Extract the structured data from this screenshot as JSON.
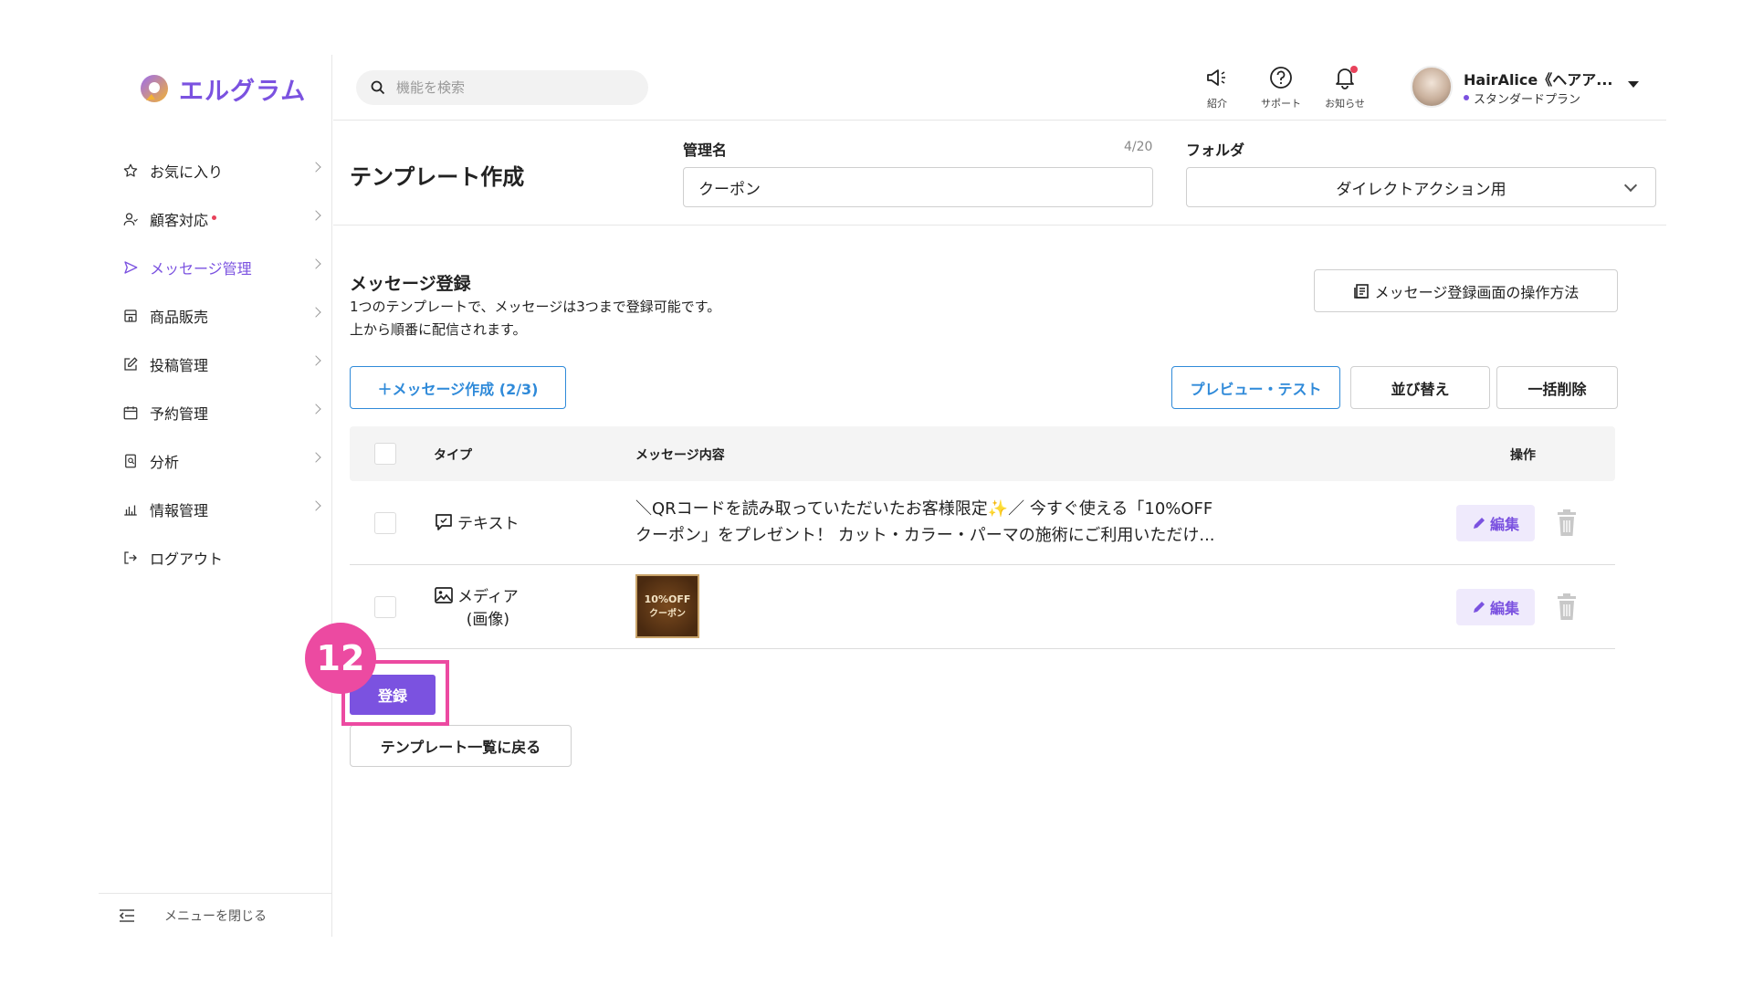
{
  "app": {
    "name": "エルグラム",
    "brand_color": "#7b52e0",
    "accent_pink": "#ec4aa1"
  },
  "sidebar": {
    "items": [
      {
        "label": "お気に入り",
        "icon": "star-icon"
      },
      {
        "label": "顧客対応",
        "icon": "user-icon",
        "has_dot": true
      },
      {
        "label": "メッセージ管理",
        "icon": "send-icon",
        "active": true
      },
      {
        "label": "商品販売",
        "icon": "shop-icon"
      },
      {
        "label": "投稿管理",
        "icon": "edit-icon"
      },
      {
        "label": "予約管理",
        "icon": "calendar-icon"
      },
      {
        "label": "分析",
        "icon": "report-icon"
      },
      {
        "label": "情報管理",
        "icon": "bar-chart-icon"
      },
      {
        "label": "ログアウト",
        "icon": "logout-icon"
      }
    ],
    "footer_label": "メニューを閉じる"
  },
  "header": {
    "search_placeholder": "機能を検索",
    "icons": [
      {
        "label": "紹介",
        "icon": "megaphone-icon"
      },
      {
        "label": "サポート",
        "icon": "help-icon"
      },
      {
        "label": "お知らせ",
        "icon": "bell-icon"
      }
    ],
    "user_name": "HairAlice《ヘアア...",
    "user_plan": "スタンダードプラン"
  },
  "form": {
    "page_title": "テンプレート作成",
    "name_label": "管理名",
    "name_counter": "4/20",
    "name_value": "クーポン",
    "folder_label": "フォルダ",
    "folder_value": "ダイレクトアクション用"
  },
  "messages": {
    "title": "メッセージ登録",
    "desc_line1": "1つのテンプレートで、メッセージは3つまで登録可能です。",
    "desc_line2": "上から順番に配信されます。",
    "howto_button": "メッセージ登録画面の操作方法",
    "create_button": "＋メッセージ作成 (2/3)",
    "preview_button": "プレビュー・テスト",
    "sort_button": "並び替え",
    "bulk_delete_button": "一括削除",
    "columns": {
      "type": "タイプ",
      "content": "メッセージ内容",
      "actions": "操作"
    },
    "rows": [
      {
        "type": "テキスト",
        "content_line1": "＼QRコードを読み取っていただいたお客様限定✨／ 今すぐ使える「10%OFF",
        "content_line2": "クーポン」をプレゼント！ カット・カラー・パーマの施術にご利用いただけ...",
        "edit_label": "編集"
      },
      {
        "type_line1": "メディア",
        "type_line2": "(画像)",
        "thumb_line1": "10%OFF",
        "thumb_line2": "クーポン",
        "edit_label": "編集"
      }
    ]
  },
  "footer_buttons": {
    "register": "登録",
    "back": "テンプレート一覧に戻る"
  },
  "step_badge": "12"
}
